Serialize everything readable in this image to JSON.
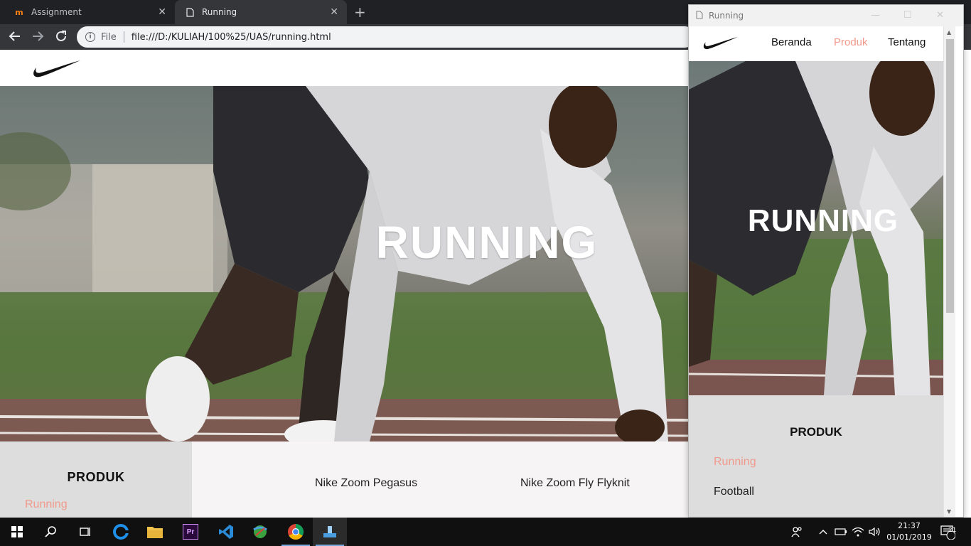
{
  "browser": {
    "tabs": [
      {
        "title": "Assignment",
        "icon": "moodle-icon"
      },
      {
        "title": "Running",
        "icon": "page-icon"
      }
    ],
    "address": {
      "scheme_label": "File",
      "url": "file:///D:/KULIAH/100%25/UAS/running.html"
    }
  },
  "page": {
    "hero_title": "RUNNING",
    "sidebar": {
      "heading": "PRODUK",
      "items": [
        "Running"
      ]
    },
    "products": [
      "Nike Zoom Pegasus",
      "Nike Zoom Fly Flyknit"
    ]
  },
  "popup": {
    "title": "Running",
    "nav": {
      "home": "Beranda",
      "products": "Produk",
      "about": "Tentang"
    },
    "hero_title": "RUNNING",
    "sidebar": {
      "heading": "PRODUK",
      "items": [
        "Running",
        "Football"
      ]
    }
  },
  "taskbar": {
    "time": "21:37",
    "date": "01/01/2019",
    "notification_count": "21"
  },
  "colors": {
    "accent": "#f09a8c",
    "dark": "#111111",
    "sidebar_bg": "#dddddd"
  }
}
